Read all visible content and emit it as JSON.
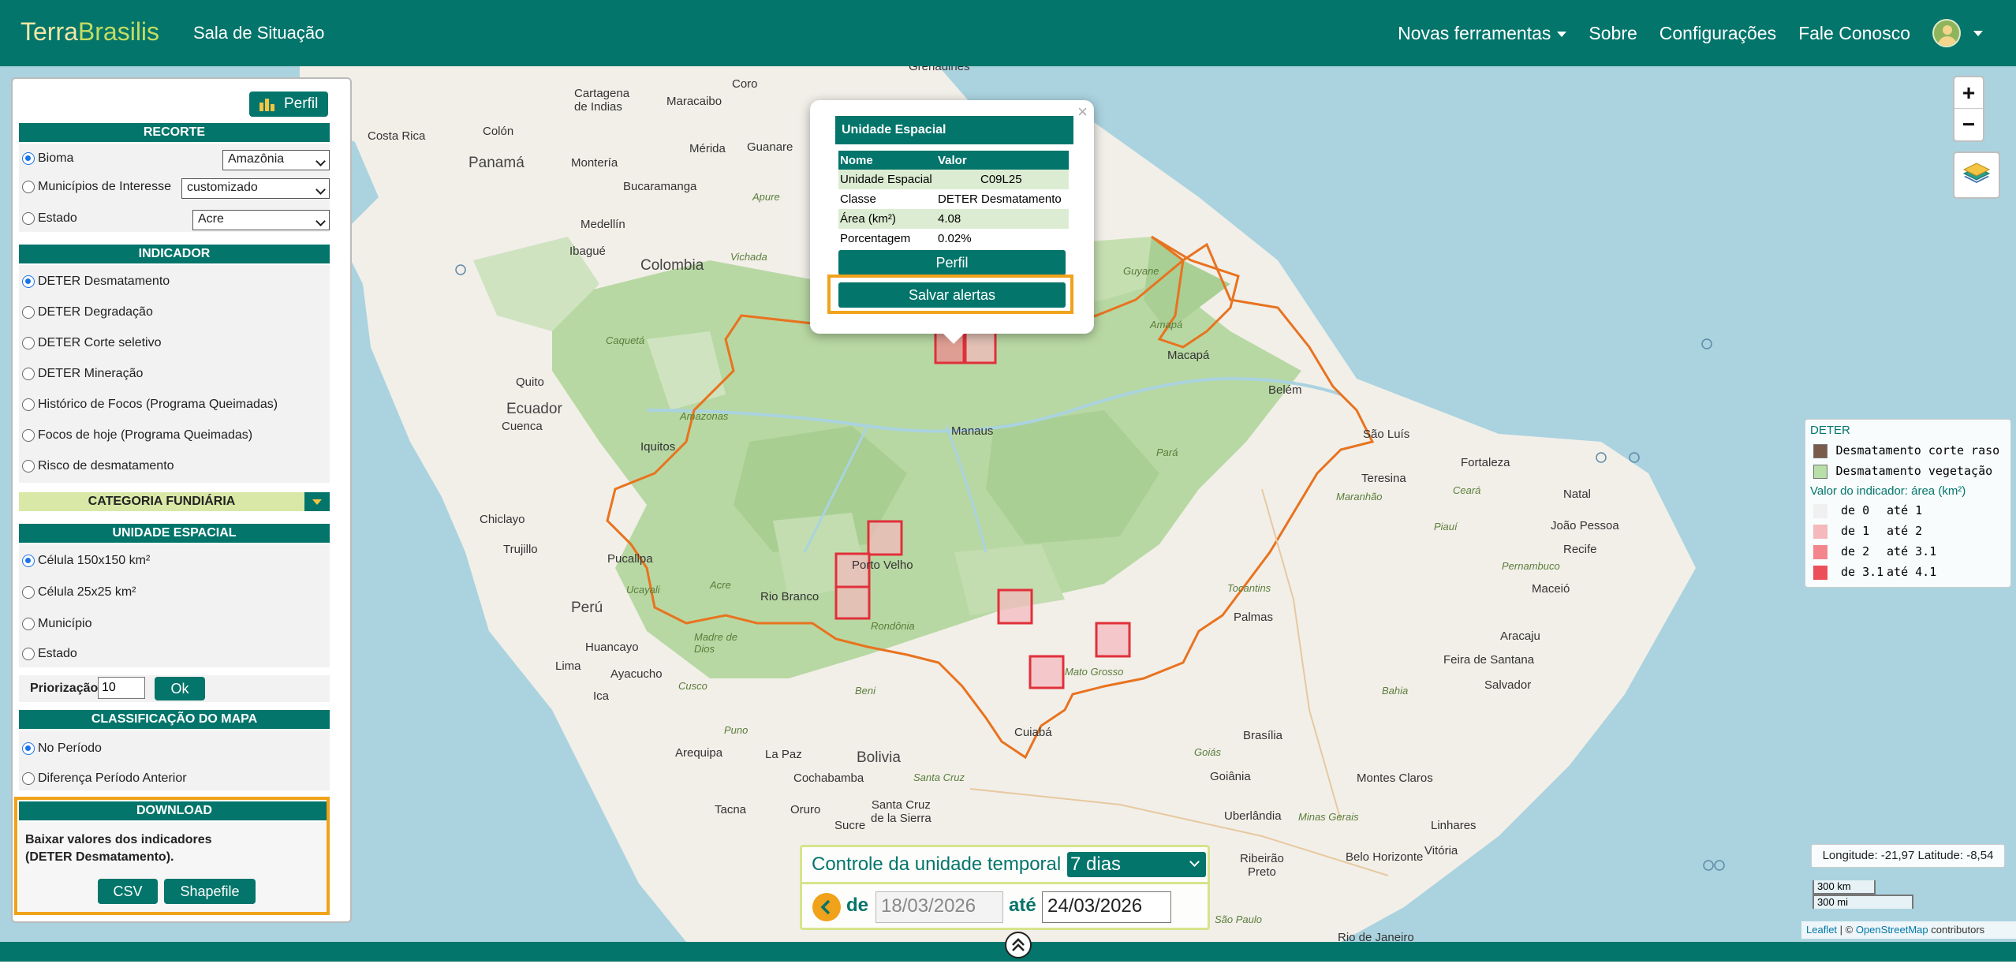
{
  "navbar": {
    "brand_part1": "Terra",
    "brand_part2": "Brasilis",
    "subtitle": "Sala de Situação",
    "links": [
      "Novas ferramentas",
      "Sobre",
      "Configurações",
      "Fale Conosco"
    ]
  },
  "sidebar": {
    "perfil_button": "Perfil",
    "recorte": {
      "title": "RECORTE",
      "rows": [
        {
          "label": "Bioma",
          "value": "Amazônia",
          "selected": true
        },
        {
          "label": "Municípios de Interesse",
          "value": "customizado",
          "selected": false
        },
        {
          "label": "Estado",
          "value": "Acre",
          "selected": false
        }
      ]
    },
    "indicador": {
      "title": "INDICADOR",
      "options": [
        "DETER Desmatamento",
        "DETER Degradação",
        "DETER Corte seletivo",
        "DETER Mineração",
        "Histórico de Focos (Programa Queimadas)",
        "Focos de hoje (Programa Queimadas)",
        "Risco de desmatamento"
      ],
      "selected": "DETER Desmatamento"
    },
    "categoria_fundiaria": "CATEGORIA FUNDIÁRIA",
    "unidade_espacial": {
      "title": "UNIDADE ESPACIAL",
      "options": [
        "Célula 150x150 km²",
        "Célula 25x25 km²",
        "Município",
        "Estado"
      ],
      "selected": "Célula 150x150 km²"
    },
    "priorizacao": {
      "label": "Priorização",
      "value": "10",
      "button": "Ok"
    },
    "classificacao": {
      "title": "CLASSIFICAÇÃO DO MAPA",
      "options": [
        "No Período",
        "Diferença Período Anterior"
      ],
      "selected": "No Período"
    },
    "download": {
      "title": "DOWNLOAD",
      "text_line1": "Baixar valores dos indicadores",
      "text_line2": "(DETER Desmatamento).",
      "csv": "CSV",
      "shapefile": "Shapefile"
    }
  },
  "popup": {
    "title": "Unidade Espacial",
    "close": "×",
    "headers": [
      "Nome",
      "Valor"
    ],
    "rows": [
      [
        "Unidade Espacial",
        "C09L25"
      ],
      [
        "Classe",
        "DETER Desmatamento"
      ],
      [
        "Área (km²)",
        "4.08"
      ],
      [
        "Porcentagem",
        "0.02%"
      ]
    ],
    "perfil_button": "Perfil",
    "salvar_button": "Salvar alertas"
  },
  "legend": {
    "title": "DETER",
    "classes": [
      {
        "label": "Desmatamento corte raso",
        "color": "#7a5a4a"
      },
      {
        "label": "Desmatamento vegetação",
        "color": "#b9dfa9"
      }
    ],
    "indicator_title": "Valor do indicador: área (km²)",
    "ranges": [
      {
        "de": "de 0",
        "ate": "até 1",
        "color": "#f0f0f0"
      },
      {
        "de": "de 1",
        "ate": "até 2",
        "color": "#f5b8bc"
      },
      {
        "de": "de 2",
        "ate": "até 3.1",
        "color": "#f2868c"
      },
      {
        "de": "de 3.1",
        "ate": "até 4.1",
        "color": "#ec4f59"
      }
    ]
  },
  "temporal": {
    "title": "Controle da unidade temporal",
    "period": "7 dias",
    "de_label": "de",
    "ate_label": "até",
    "date_from": "18/03/2026",
    "date_to": "24/03/2026"
  },
  "map": {
    "coords": "Longitude: -21,97 Latitude: -8,54",
    "scale_km": "300 km",
    "scale_mi": "300 mi",
    "attribution_leaflet": "Leaflet",
    "attribution_sep": " | © ",
    "attribution_osm": "OpenStreetMap",
    "attribution_tail": " contributors",
    "zoom_in": "+",
    "zoom_out": "−",
    "labels": {
      "grenadines": "Grenadines",
      "cartagena": "Cartagena\nde Indias",
      "maracaibo": "Maracaibo",
      "coro": "Coro",
      "costa_rica": "Costa Rica",
      "colon": "Colón",
      "panama": "Panamá",
      "monteria": "Montería",
      "merida": "Mérida",
      "guanare": "Guanare",
      "bucaramanga": "Bucaramanga",
      "apure": "Apure",
      "medellin": "Medellín",
      "ibague": "Ibagué",
      "colombia": "Colombia",
      "vichada": "Vichada",
      "guyane": "Guyane",
      "caqueta": "Caquetá",
      "amapa": "Amapá",
      "macapa": "Macapá",
      "belem": "Belém",
      "quito": "Quito",
      "ecuador": "Ecuador",
      "cuenca": "Cuenca",
      "amazonas": "Amazonas",
      "manaus": "Manaus",
      "para": "Pará",
      "iquitos": "Iquitos",
      "sao_luis": "São Luís",
      "fortaleza": "Fortaleza",
      "teresina": "Teresina",
      "maranhao": "Maranhão",
      "ceara": "Ceará",
      "natal": "Natal",
      "chiclayo": "Chiclayo",
      "trujillo": "Trujillo",
      "pucallpa": "Pucallpa",
      "ucayali": "Ucayali",
      "acre": "Acre",
      "rio_branco": "Rio Branco",
      "porto_velho": "Porto Velho",
      "piaui": "Piauí",
      "joao_pessoa": "João Pessoa",
      "recife": "Recife",
      "pernambuco": "Pernambuco",
      "maceio": "Maceió",
      "peru": "Perú",
      "tocantins": "Tocantins",
      "palmas": "Palmas",
      "huancayo": "Huancayo",
      "lima": "Lima",
      "madre_de_dios": "Madre de\nDios",
      "rondonia": "Rondônia",
      "aracaju": "Aracaju",
      "feira": "Feira de Santana",
      "ayacucho": "Ayacucho",
      "cusco": "Cusco",
      "beni": "Beni",
      "mato_grosso": "Mato Grosso",
      "bahia": "Bahia",
      "salvador": "Salvador",
      "ica": "Ica",
      "puno": "Puno",
      "cuiaba": "Cuiabá",
      "brasilia": "Brasília",
      "arequipa": "Arequipa",
      "la_paz": "La Paz",
      "bolivia": "Bolivia",
      "goias": "Goiás",
      "goiania": "Goiânia",
      "montes_claros": "Montes Claros",
      "cochabamba": "Cochabamba",
      "santa_cruz": "Santa Cruz",
      "santa_cruz_sierra": "Santa Cruz\nde la Sierra",
      "tacna": "Tacna",
      "oruro": "Oruro",
      "sucre": "Sucre",
      "uberlandia": "Uberlândia",
      "minas_gerais": "Minas Gerais",
      "linhares": "Linhares",
      "belo_horizonte": "Belo Horizonte",
      "vitoria": "Vitória",
      "ribeirao_preto": "Ribeirão\nPreto",
      "sao_paulo": "São Paulo",
      "rio_de_janeiro": "Rio de Janeiro"
    }
  },
  "colors": {
    "brand_green": "#03756b",
    "highlight_orange": "#f0a21b",
    "amazon_border": "#e8731f",
    "cell_red": "#e0303a"
  }
}
